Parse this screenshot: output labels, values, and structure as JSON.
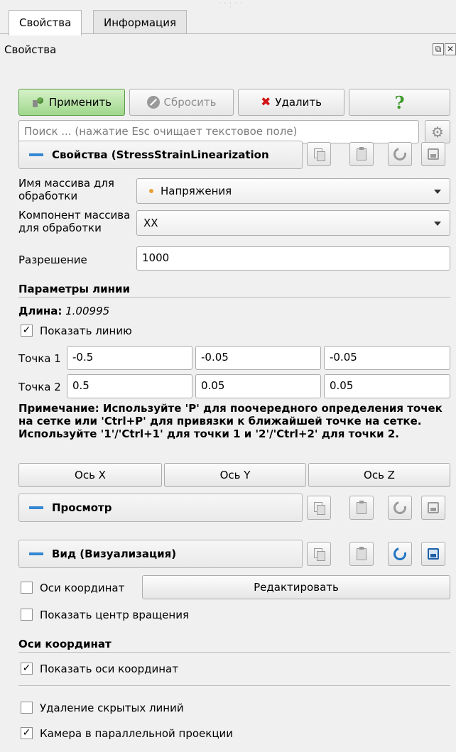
{
  "tabs": [
    {
      "label": "Свойства",
      "active": true
    },
    {
      "label": "Информация",
      "active": false
    }
  ],
  "panel_title": "Свойства",
  "toolbar": {
    "apply": "Применить",
    "reset": "Сбросить",
    "delete": "Удалить",
    "help": "?"
  },
  "search": {
    "placeholder": "Поиск ... (нажатие Esc очищает текстовое поле)"
  },
  "properties_section": {
    "title": "Свойства (StressStrainLinearization"
  },
  "fields": {
    "array_name_label": "Имя массива для обработки",
    "array_name_value": "Напряжения",
    "array_component_label": "Компонент массива для обработки",
    "array_component_value": "XX",
    "resolution_label": "Разрешение",
    "resolution_value": "1000"
  },
  "line_params": {
    "header": "Параметры линии",
    "length_label": "Длина:",
    "length_value": "1.00995",
    "show_line_label": "Показать линию",
    "show_line_checked": true,
    "point1_label": "Точка 1",
    "point1": [
      "-0.5",
      "-0.05",
      "-0.05"
    ],
    "point2_label": "Точка 2",
    "point2": [
      "0.5",
      "0.05",
      "0.05"
    ],
    "note": "Примечание: Используйте 'P' для поочередного определения точек на сетке или 'Ctrl+P' для привязки к ближайшей точке на сетке. Используйте '1'/'Ctrl+1' для точки 1 и '2'/'Ctrl+2' для точки 2.",
    "axis_x": "Ось X",
    "axis_y": "Ось Y",
    "axis_z": "Ось Z"
  },
  "view_section": {
    "title": "Просмотр"
  },
  "display_section": {
    "title": "Вид (Визуализация)"
  },
  "display": {
    "axes_label": "Оси координат",
    "axes_checked": false,
    "edit_button": "Редактировать",
    "show_center_label": "Показать центр вращения",
    "show_center_checked": false
  },
  "axes_group": {
    "header": "Оси координат",
    "show_axes_label": "Показать оси координат",
    "show_axes_checked": true
  },
  "hidden_lines": {
    "label": "Удаление скрытых линий",
    "checked": false
  },
  "parallel_projection": {
    "label": "Камера в параллельной проекции",
    "checked": true
  },
  "colors": {
    "accent": "#3487d1",
    "apply_green": "#9fd78b",
    "delete_red": "#d21414",
    "help_green": "#3f9a2c"
  }
}
